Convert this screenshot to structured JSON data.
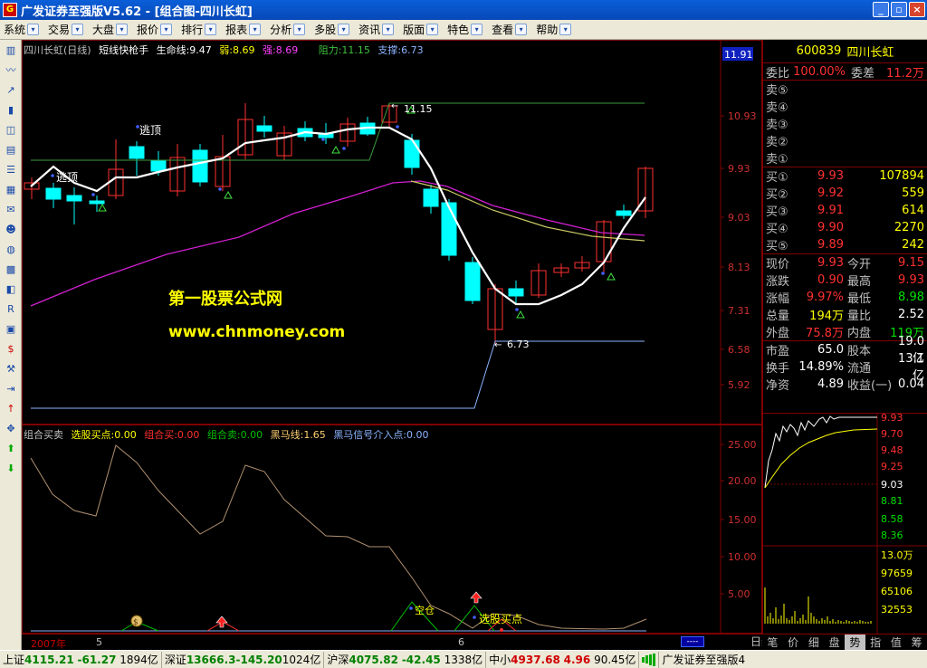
{
  "window": {
    "title": "广发证券至强版V5.62 - [组合图-四川长虹]",
    "app_icon": "app-logo-icon",
    "minimize": "_",
    "restore": "▫",
    "close": "×"
  },
  "menu": {
    "items": [
      "系统",
      "交易",
      "大盘",
      "报价",
      "排行",
      "报表",
      "分析",
      "多股",
      "资讯",
      "版面",
      "特色",
      "查看",
      "帮助"
    ],
    "dropdown_glyph": "▾"
  },
  "toolbar": {
    "icons": [
      "kline-icon",
      "minute-icon",
      "trend-icon",
      "bar-icon",
      "indicator-icon",
      "report-icon",
      "list-icon",
      "text-icon",
      "mail-icon",
      "people-icon",
      "globe-icon",
      "chart-icon",
      "fund-icon",
      "ri-icon",
      "calc-icon",
      "money-icon",
      "tools-icon",
      "export-icon",
      "arrow-up-icon",
      "move-icon",
      "arrow-up-green-icon",
      "arrow-down-green-icon"
    ]
  },
  "main_chart": {
    "legend": {
      "stock": "四川长虹(日线)",
      "indicator": "短线快枪手",
      "lifeline": "生命线:9.47",
      "weak": "弱:8.69",
      "strong": "强:8.69",
      "resistance": "阻力:11.15",
      "support": "支撑:6.73"
    },
    "current_price_tag": "11.91",
    "y_labels": [
      "10.93",
      "9.93",
      "9.03",
      "8.13",
      "7.31",
      "6.58",
      "5.92"
    ],
    "annotations": {
      "escape_top_1": "逃顶",
      "escape_top_2": "逃顶",
      "high_mark": "11.15",
      "low_mark": "6.73"
    },
    "watermark_line1": "第一股票公式网",
    "watermark_line2": "www.chnmoney.com"
  },
  "sub_chart": {
    "legend": {
      "name": "组合买卖",
      "pick_buy": "选股买点:0.00",
      "combo_buy": "组合买:0.00",
      "combo_sell": "组合卖:0.00",
      "black_horse": "黑马线:1.65",
      "black_horse_signal": "黑马信号介入点:0.00"
    },
    "y_labels": [
      "25.00",
      "20.00",
      "15.00",
      "10.00",
      "5.00"
    ],
    "annotations": {
      "empty_position": "空仓",
      "pick_buy_point": "选股买点"
    }
  },
  "date_axis": {
    "year_label": "2007年",
    "month_5": "5",
    "month_6": "6",
    "period_button": "日线"
  },
  "quote": {
    "code": "600839",
    "name": "四川长虹",
    "ratio_label": "委比",
    "ratio_value": "100.00%",
    "diff_label": "委差",
    "diff_value": "11.2万",
    "sells": [
      {
        "label": "卖⑤",
        "price": "",
        "vol": ""
      },
      {
        "label": "卖④",
        "price": "",
        "vol": ""
      },
      {
        "label": "卖③",
        "price": "",
        "vol": ""
      },
      {
        "label": "卖②",
        "price": "",
        "vol": ""
      },
      {
        "label": "卖①",
        "price": "",
        "vol": ""
      }
    ],
    "buys": [
      {
        "label": "买①",
        "price": "9.93",
        "vol": "107894"
      },
      {
        "label": "买②",
        "price": "9.92",
        "vol": "559"
      },
      {
        "label": "买③",
        "price": "9.91",
        "vol": "614"
      },
      {
        "label": "买④",
        "price": "9.90",
        "vol": "2270"
      },
      {
        "label": "买⑤",
        "price": "9.89",
        "vol": "242"
      }
    ],
    "stats": [
      {
        "l1": "现价",
        "v1": "9.93",
        "c1": "#ff3030",
        "l2": "今开",
        "v2": "9.15",
        "c2": "#ff3030"
      },
      {
        "l1": "涨跌",
        "v1": "0.90",
        "c1": "#ff3030",
        "l2": "最高",
        "v2": "9.93",
        "c2": "#ff3030"
      },
      {
        "l1": "涨幅",
        "v1": "9.97%",
        "c1": "#ff3030",
        "l2": "最低",
        "v2": "8.98",
        "c2": "#00e000"
      },
      {
        "l1": "总量",
        "v1": "194万",
        "c1": "#ffff00",
        "l2": "量比",
        "v2": "2.52",
        "c2": "#ffffff"
      },
      {
        "l1": "外盘",
        "v1": "75.8万",
        "c1": "#ff3030",
        "l2": "内盘",
        "v2": "119万",
        "c2": "#00e000"
      }
    ],
    "stats2": [
      {
        "l1": "市盈",
        "v1": "65.0",
        "l2": "股本",
        "v2": "19.0亿"
      },
      {
        "l1": "换手",
        "v1": "14.89%",
        "l2": "流通",
        "v2": "13.1亿"
      },
      {
        "l1": "净资",
        "v1": "4.89",
        "l2": "收益(一)",
        "v2": "0.04"
      }
    ]
  },
  "mini_chart": {
    "price_labels": [
      "9.93",
      "9.70",
      "9.48",
      "9.25",
      "9.03",
      "8.81",
      "8.58",
      "8.36"
    ],
    "vol_labels": [
      "13.0万",
      "97659",
      "65106",
      "32553"
    ]
  },
  "quote_tabs": [
    "笔",
    "价",
    "细",
    "盘",
    "势",
    "指",
    "值",
    "筹"
  ],
  "quote_tab_active": "势",
  "status": {
    "sh_label": "上证",
    "sh_index": "4115.21",
    "sh_change": "-61.27",
    "sh_amount": "1894亿",
    "sz_label": "深证",
    "sz_index": "13666.3",
    "sz_change": "-145.20",
    "sz_amount": "1024亿",
    "hs_label": "沪深",
    "hs_index": "4075.82",
    "hs_change": "-42.45",
    "hs_amount": "1338亿",
    "zx_label": "中小",
    "zx_index": "4937.68",
    "zx_change": "4.96",
    "zx_amount": "90.45亿",
    "app_name": "广发证券至强版4"
  },
  "colors": {
    "up": "#ff3030",
    "down": "#00ffff",
    "lifeline": "#ffffff",
    "ma_yellow": "#c8c864",
    "ma_magenta": "#d020d0",
    "resistance": "#3c9c3c",
    "support": "#8cb4ff",
    "grid_red": "#800000"
  }
}
